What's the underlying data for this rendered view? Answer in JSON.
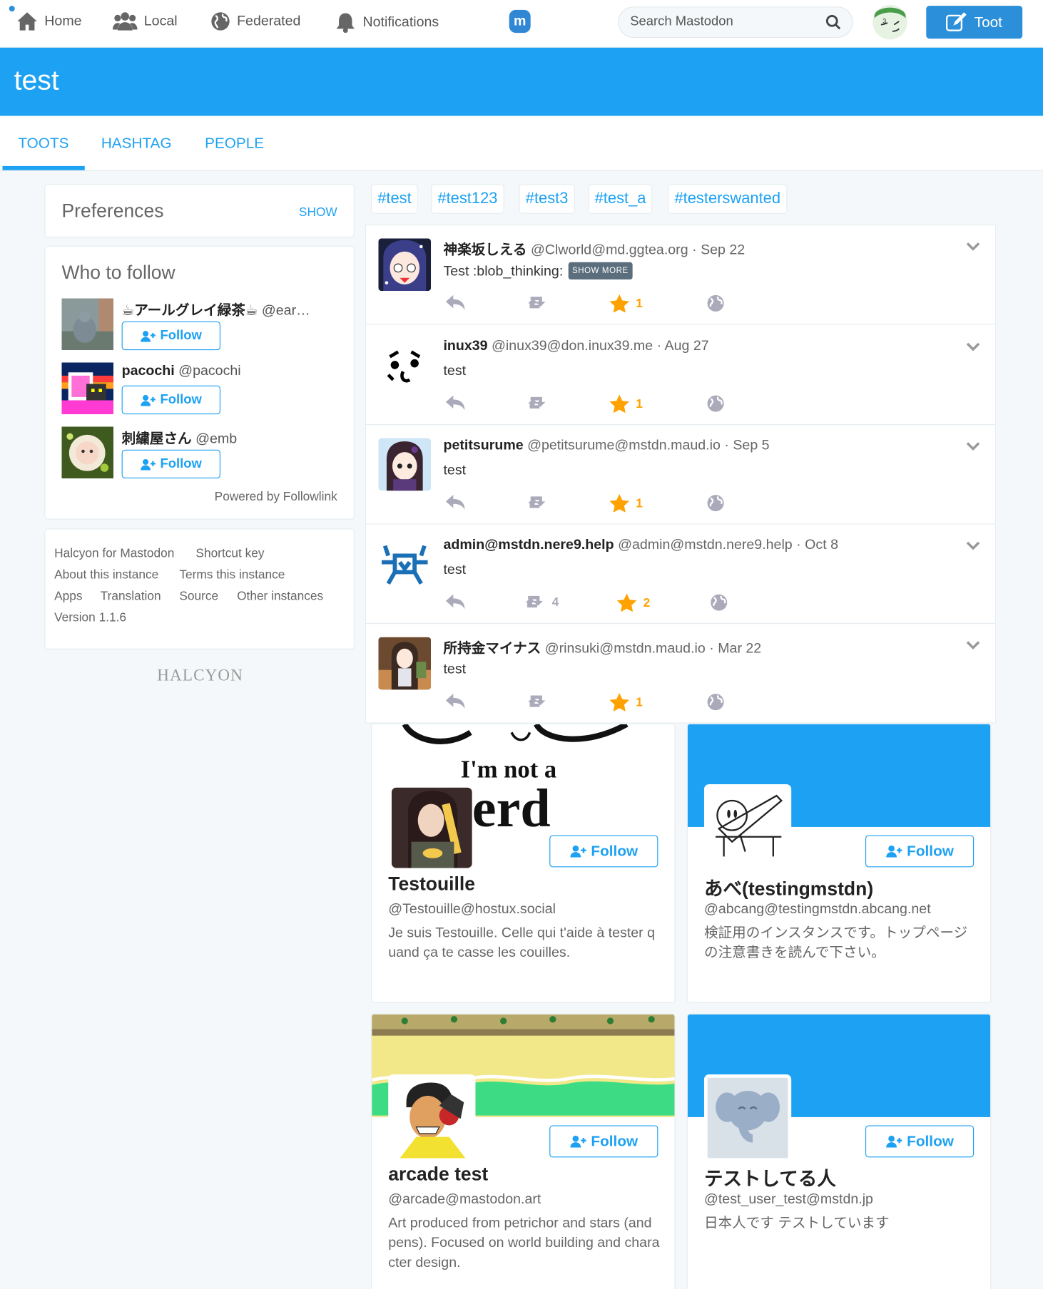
{
  "nav": {
    "home": "Home",
    "local": "Local",
    "federated": "Federated",
    "notifications": "Notifications",
    "search_placeholder": "Search Mastodon",
    "toot": "Toot"
  },
  "page": {
    "title": "test",
    "tabs": [
      "TOOTS",
      "HASHTAG",
      "PEOPLE"
    ],
    "active_tab": "TOOTS"
  },
  "sidebar": {
    "preferences": {
      "title": "Preferences",
      "toggle": "SHOW"
    },
    "who_to_follow": {
      "title": "Who to follow",
      "follow_label": "Follow",
      "users": [
        {
          "name": "☕アールグレイ緑茶☕",
          "handle": "@ear…"
        },
        {
          "name": "pacochi",
          "handle": "@pacochi"
        },
        {
          "name": "刺繍屋さん",
          "handle": "@emb"
        }
      ],
      "powered_by": "Powered by Followlink"
    },
    "footer_links": [
      "Halcyon for Mastodon",
      "Shortcut key",
      "About this instance",
      "Terms this instance",
      "Apps",
      "Translation",
      "Source",
      "Other instances"
    ],
    "version": "Version 1.1.6",
    "brand": "HALCYON"
  },
  "hashtags": [
    "#test",
    "#test123",
    "#test3",
    "#test_a",
    "#testerswanted"
  ],
  "statuses": [
    {
      "name": "神楽坂しえる",
      "acct": "@Clworld@md.ggtea.org",
      "date": "Sep 22",
      "content": "Test :blob_thinking:",
      "show_more": "SHOW MORE",
      "boosts": "",
      "favs": "1"
    },
    {
      "name": "inux39",
      "acct": "@inux39@don.inux39.me",
      "date": "Aug 27",
      "content": "test",
      "boosts": "",
      "favs": "1"
    },
    {
      "name": "petitsurume",
      "acct": "@petitsurume@mstdn.maud.io",
      "date": "Sep 5",
      "content": "test",
      "boosts": "",
      "favs": "1"
    },
    {
      "name": "admin@mstdn.nere9.help",
      "acct": "@admin@mstdn.nere9.help",
      "date": "Oct 8",
      "content": "test",
      "boosts": "4",
      "favs": "2"
    },
    {
      "name": "所持金マイナス",
      "acct": "@rinsuki@mstdn.maud.io",
      "date": "Mar 22",
      "content": "test",
      "boosts": "",
      "favs": "1"
    }
  ],
  "people": [
    {
      "name": "Testouille",
      "acct": "@Testouille@hostux.social",
      "note": "Je suis Testouille. Celle qui t'aide à tester quand ça te casse les couilles.",
      "header_text_1": "I'm not a",
      "header_text_2": "erd"
    },
    {
      "name": "あべ(testingmstdn)",
      "acct": "@abcang@testingmstdn.abcang.net",
      "note": "検証用のインスタンスです。トップページの注意書きを読んで下さい。"
    },
    {
      "name": "arcade test",
      "acct": "@arcade@mastodon.art",
      "note": "Art produced from petrichor and stars (and pens). Focused on world building and character design."
    },
    {
      "name": "テストしてる人",
      "acct": "@test_user_test@mstdn.jp",
      "note": "日本人です テストしています"
    }
  ],
  "colors": {
    "accent": "#1da1f2",
    "banner": "#1da1f2",
    "star": "#ffa200",
    "toot_button": "#2b90d9"
  }
}
